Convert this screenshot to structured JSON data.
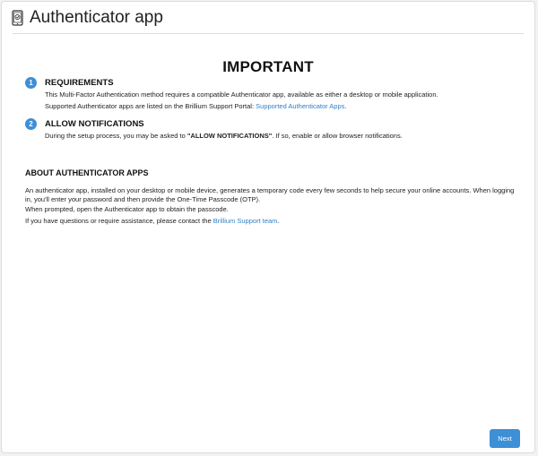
{
  "header": {
    "title": "Authenticator app",
    "icon": "authenticator-app-icon"
  },
  "main": {
    "heading": "IMPORTANT",
    "steps": [
      {
        "number": "1",
        "title": "REQUIREMENTS",
        "line1": "This Multi-Factor Authentication method requires a compatible Authenticator app, available as either a desktop or mobile application.",
        "line2_prefix": "Supported Authenticator apps are listed on the Brillium Support Portal: ",
        "line2_link": "Supported Authenticator Apps",
        "line2_suffix": "."
      },
      {
        "number": "2",
        "title": "ALLOW NOTIFICATIONS",
        "line1_prefix": "During the setup process, you may be asked to ",
        "line1_bold": "\"ALLOW NOTIFICATIONS\"",
        "line1_suffix": ". If so, enable or allow browser notifications."
      }
    ],
    "about": {
      "title": "ABOUT AUTHENTICATOR APPS",
      "paragraph1": "An authenticator app, installed on your desktop or mobile device, generates a temporary code every few seconds to help secure your online accounts. When logging in, you'll enter your password and then provide the One-Time Passcode (OTP).",
      "paragraph2": "When prompted, open the Authenticator app to obtain the passcode.",
      "paragraph3_prefix": "If you have questions or require assistance, please contact the ",
      "paragraph3_link": "Brillium Support team",
      "paragraph3_suffix": "."
    }
  },
  "footer": {
    "next_label": "Next"
  },
  "colors": {
    "accent": "#3d8fd6",
    "link": "#2f7fc7"
  }
}
